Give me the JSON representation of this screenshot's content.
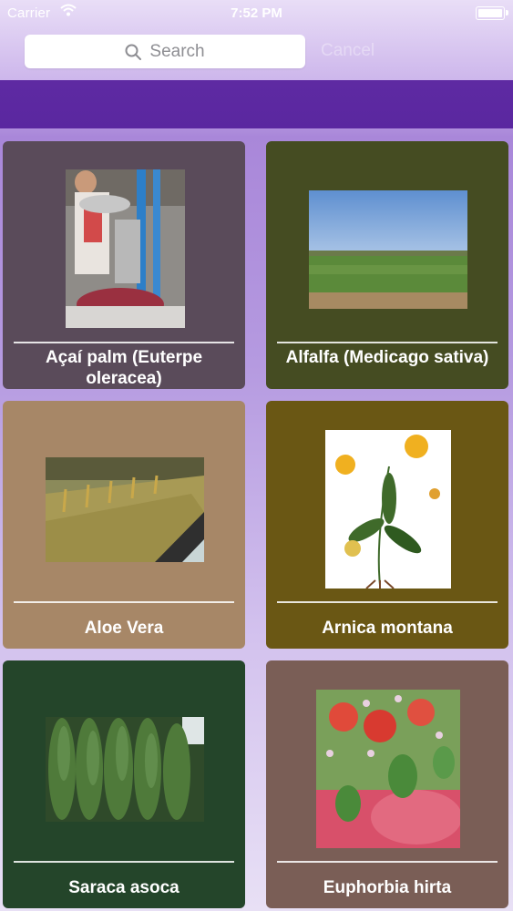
{
  "status_bar": {
    "carrier": "Carrier",
    "time": "7:52 PM"
  },
  "search": {
    "placeholder": "Search",
    "cancel_label": "Cancel"
  },
  "plants": [
    {
      "name": "Açaí palm (Euterpe oleracea)",
      "bg": "#5a4b5a"
    },
    {
      "name": "Alfalfa (Medicago sativa)",
      "bg": "#454c22"
    },
    {
      "name": "Aloe Vera",
      "bg": "#a78767"
    },
    {
      "name": "Arnica montana",
      "bg": "#6a5714"
    },
    {
      "name": "Saraca asoca",
      "bg": "#24452a"
    },
    {
      "name": "Euphorbia hirta",
      "bg": "#7a5e56"
    }
  ]
}
